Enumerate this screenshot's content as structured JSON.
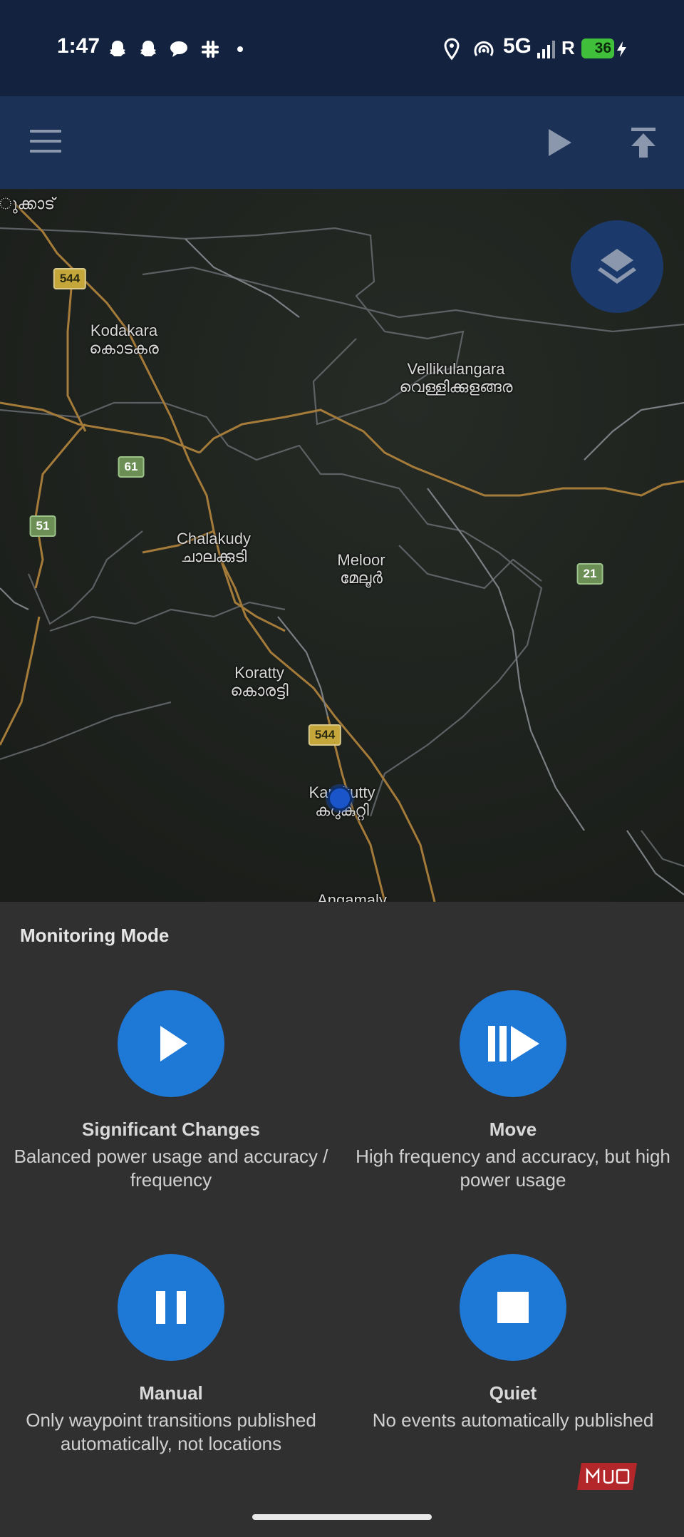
{
  "status_bar": {
    "time": "1:47",
    "network": "5G",
    "roaming": "R",
    "battery": "36",
    "icons": [
      "snapchat-icon",
      "snapchat-icon",
      "chat-icon",
      "slack-icon",
      "dot-icon",
      "location-icon",
      "hotspot-icon",
      "signal-icon",
      "battery-icon"
    ]
  },
  "toolbar": {
    "icons": [
      "menu-icon",
      "play-icon",
      "publish-icon"
    ]
  },
  "map": {
    "places": [
      {
        "en": "Kodakara",
        "ml": "കൊടകര"
      },
      {
        "en": "Vellikulangara",
        "ml": "വെള്ളിക്കുളങ്ങര"
      },
      {
        "en": "Chalakudy",
        "ml": "ചാലക്കുടി"
      },
      {
        "en": "Meloor",
        "ml": "മേലൂർ"
      },
      {
        "en": "Koratty",
        "ml": "കൊരട്ടി"
      },
      {
        "en": "Karukutty",
        "ml": "കറുകുറ്റി"
      },
      {
        "en": "Angamaly",
        "ml": ""
      },
      {
        "en": "",
        "ml": "ുക്കാട്"
      }
    ],
    "shields": [
      "544",
      "61",
      "51",
      "21",
      "544"
    ],
    "layers_icon": "layers-icon"
  },
  "sheet": {
    "title": "Monitoring Mode",
    "modes": [
      {
        "title": "Significant Changes",
        "desc": "Balanced power usage and accuracy / frequency",
        "icon": "play-icon"
      },
      {
        "title": "Move",
        "desc": "High frequency and accuracy, but high power usage",
        "icon": "fast-forward-icon"
      },
      {
        "title": "Manual",
        "desc": "Only waypoint transitions published automatically, not locations",
        "icon": "pause-icon"
      },
      {
        "title": "Quiet",
        "desc": "No events automatically published",
        "icon": "stop-icon"
      }
    ]
  },
  "watermark": "MUO",
  "colors": {
    "status_bar": "#13223f",
    "toolbar": "#1b3256",
    "accent": "#1e78d6",
    "sheet": "#303030"
  }
}
